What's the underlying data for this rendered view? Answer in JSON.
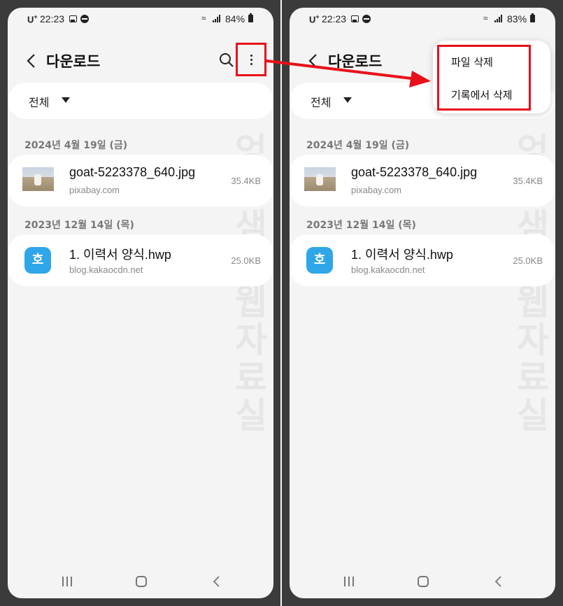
{
  "status_left": {
    "carrier": "U",
    "carrier_plus": "+",
    "time": "22:23",
    "battery": "84%"
  },
  "status_right": {
    "carrier": "U",
    "carrier_plus": "+",
    "time": "22:23",
    "battery": "83%"
  },
  "appbar": {
    "title": "다운로드",
    "icons": [
      "back-icon",
      "search-icon",
      "more-options-icon"
    ]
  },
  "filter": {
    "label": "전체"
  },
  "groups": [
    {
      "date": "2024년 4월 19일 (금)",
      "files": [
        {
          "name": "goat-5223378_640.jpg",
          "source": "pixabay.com",
          "size": "35.4KB"
        }
      ]
    },
    {
      "date": "2023년 12월 14일 (목)",
      "files": [
        {
          "name": "1. 이력서 양식.hwp",
          "source": "blog.kakaocdn.net",
          "size": "25.0KB",
          "icon_glyph": "호"
        }
      ]
    }
  ],
  "menu": {
    "items": [
      "파일 삭제",
      "기록에서 삭제"
    ]
  },
  "watermark": "엉클샘의웹자료실",
  "colors": {
    "highlight": "#e8101a",
    "hwp_icon": "#2fa6e8"
  }
}
